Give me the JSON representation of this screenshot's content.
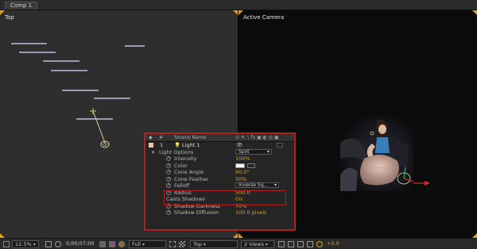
{
  "tab": {
    "label": "Comp 1"
  },
  "viewers": {
    "left_label": "Top",
    "right_label": "Active Camera"
  },
  "panel": {
    "header": {
      "hash": "#",
      "source_name": "Source Name"
    },
    "layer": {
      "index": "1",
      "name": "Light 1"
    },
    "light_options": {
      "label": "Light Options",
      "type": "Spot"
    },
    "props": [
      {
        "label": "Intensity",
        "value": "100%"
      },
      {
        "label": "Color",
        "value": ""
      },
      {
        "label": "Cone Angle",
        "value": "90.0°"
      },
      {
        "label": "Cone Feather",
        "value": "50%"
      },
      {
        "label": "Falloff",
        "value": "Inverse Sq..."
      },
      {
        "label": "Radius",
        "value": "500.0"
      },
      {
        "label": "Casts Shadows",
        "value": "On"
      },
      {
        "label": "Shadow Darkness",
        "value": "70%"
      },
      {
        "label": "Shadow Diffusion",
        "value": "100.0 pixels"
      }
    ]
  },
  "toolbar": {
    "zoom": "12.5%",
    "timecode": "0;00;07;00",
    "resolution": "Full",
    "view": "Top",
    "views": "2 Views",
    "exposure": "+0.0"
  },
  "colors": {
    "accent": "#d9a21b",
    "highlight": "#b02020",
    "value": "#d8a020"
  }
}
